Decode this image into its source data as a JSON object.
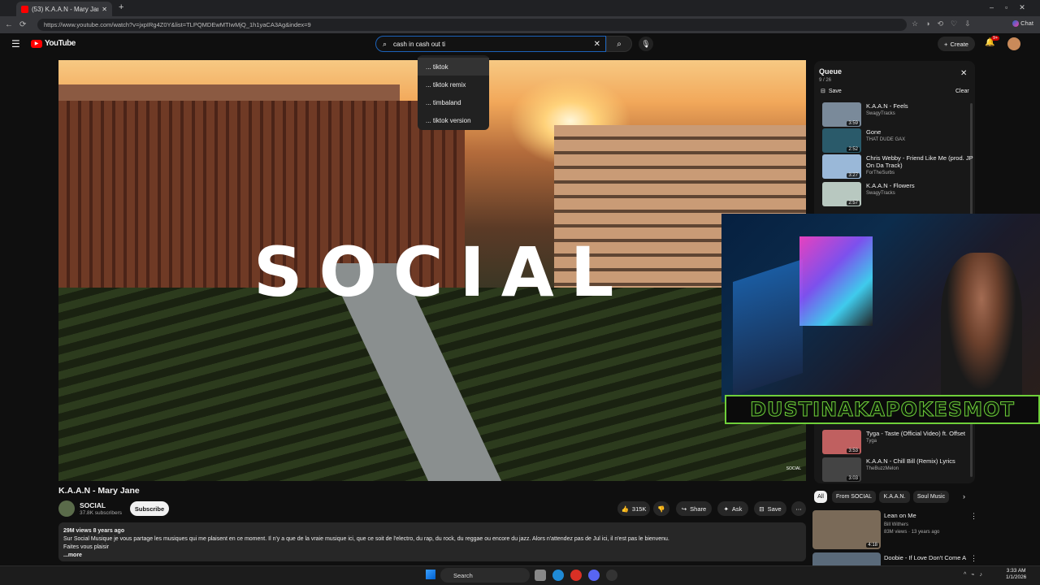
{
  "browser": {
    "tab_title": "(53) K.A.A.N - Mary Jane - You",
    "url": "https://www.youtube.com/watch?v=jxpIRg4Z0Y&list=TLPQMDEwMTIwMjQ_1h1yaCA3Ag&index=9",
    "chat_label": "Chat"
  },
  "youtube": {
    "logo_text": "YouTube",
    "search_value": "cash in cash out ti",
    "create_label": "Create",
    "notif_count": "9+",
    "suggestions": [
      "... tiktok",
      "... tiktok remix",
      "... timbaland",
      "... tiktok version"
    ]
  },
  "player": {
    "overlay_title": "SOCIAL",
    "watermark": "SOCIAL"
  },
  "queue": {
    "title": "Queue",
    "position": "9 / 26",
    "save_label": "Save",
    "clear_label": "Clear",
    "items": [
      {
        "title": "K.A.A.N - Feels",
        "channel": "SwagyTracks",
        "duration": "3:59"
      },
      {
        "title": "Gone",
        "channel": "THAT DUDE GAX",
        "duration": "2:52"
      },
      {
        "title": "Chris Webby - Friend Like Me (prod. JP On Da Track)",
        "channel": "ForTheSurbs",
        "duration": "3:27"
      },
      {
        "title": "K.A.A.N - Flowers",
        "channel": "SwagyTracks",
        "duration": "2:57"
      },
      {
        "title": "Tyga - Taste (Official Video) ft. Offset",
        "channel": "Tyga",
        "duration": "3:53"
      },
      {
        "title": "K.A.A.N - Chill Bill (Remix) Lyrics",
        "channel": "TheBuzzMelon",
        "duration": "3:03"
      }
    ]
  },
  "stream": {
    "banner": "DUSTINAKAPOKESMOT"
  },
  "video": {
    "title": "K.A.A.N - Mary Jane",
    "channel": "SOCIAL",
    "subs": "37.8K subscribers",
    "subscribe_label": "Subscribe",
    "likes": "315K",
    "share_label": "Share",
    "ask_label": "Ask",
    "save_label": "Save",
    "views_line": "29M views  8 years ago",
    "desc_line1": "Sur Social Musique je vous partage les musiques qui me plaisent en ce moment. Il n'y a que de la vraie musique ici, que ce soit de l'electro, du rap, du rock, du reggae ou encore du jazz. Alors n'attendez pas de Jul ici, il n'est pas le bienvenu.",
    "desc_line2": "Faites vous plaisir",
    "more_label": "...more"
  },
  "chips": [
    "All",
    "From SOCIAL",
    "K.A.A.N.",
    "Soul Music"
  ],
  "recs": [
    {
      "title": "Lean on Me",
      "channel": "Bill Withers",
      "meta": "83M views · 13 years ago",
      "duration": "4:18"
    },
    {
      "title": "Doobie - If Love Don't Come A",
      "channel": "",
      "meta": "",
      "duration": ""
    }
  ],
  "taskbar": {
    "search_label": "Search",
    "time": "3:33 AM",
    "date": "1/1/2026"
  }
}
